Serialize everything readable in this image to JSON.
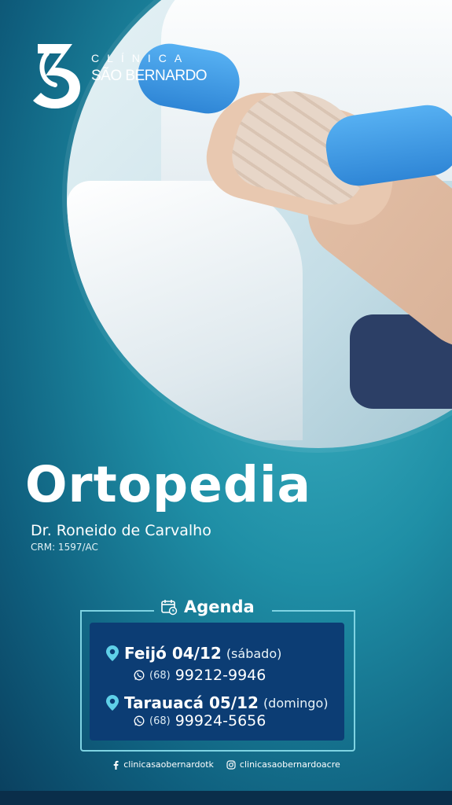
{
  "brand": {
    "line1": "CLÍNICA",
    "line2": "SÃO BERNARDO"
  },
  "specialty": "Ortopedia",
  "doctor": {
    "name": "Dr. Roneido de Carvalho",
    "crm": "CRM: 1597/AC"
  },
  "agenda": {
    "title": "Agenda",
    "entries": [
      {
        "city_date": "Feijó 04/12",
        "day": "(sábado)",
        "ddd": "(68)",
        "phone": "99212-9946"
      },
      {
        "city_date": "Tarauacá 05/12",
        "day": "(domingo)",
        "ddd": "(68)",
        "phone": "99924-5656"
      }
    ]
  },
  "social": {
    "facebook": "clinicasaobernardotk",
    "instagram": "clinicasaobernardoacre"
  },
  "colors": {
    "accent": "#7fd3e2",
    "agenda_panel": "#0c3d74",
    "pin": "#5fd0e8"
  }
}
